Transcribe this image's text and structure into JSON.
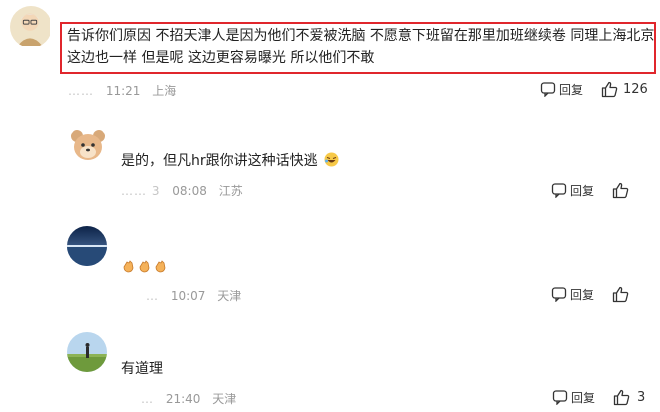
{
  "comments": [
    {
      "text_line1": "告诉你们原因 不招天津人是因为他们不爱被洗脑 不愿意下班留在那里加班继续卷 同理上海北京",
      "text_line2": "这边也一样 但是呢 这边更容易曝光 所以他们不敢",
      "date": "……",
      "time": "11:21",
      "location": "上海",
      "reply_label": "回复",
      "likes": "126"
    },
    {
      "text": "是的，但凡hr跟你讲这种话快逃",
      "date": "…… 3",
      "time": "08:08",
      "location": "江苏",
      "reply_label": "回复",
      "likes": ""
    },
    {
      "text": "",
      "date": "…",
      "time": "10:07",
      "location": "天津",
      "reply_label": "回复",
      "likes": ""
    },
    {
      "text": "有道理",
      "date": "…",
      "time": "21:40",
      "location": "天津",
      "reply_label": "回复",
      "likes": "3"
    }
  ],
  "colors": {
    "highlight": "#e0262c",
    "meta": "#999999"
  },
  "icons": [
    "avatar-elder",
    "avatar-cartoon-dog",
    "avatar-ocean",
    "avatar-meadow",
    "comment-icon",
    "thumbs-up-icon",
    "laugh-cry-emoji",
    "clap-emoji"
  ]
}
